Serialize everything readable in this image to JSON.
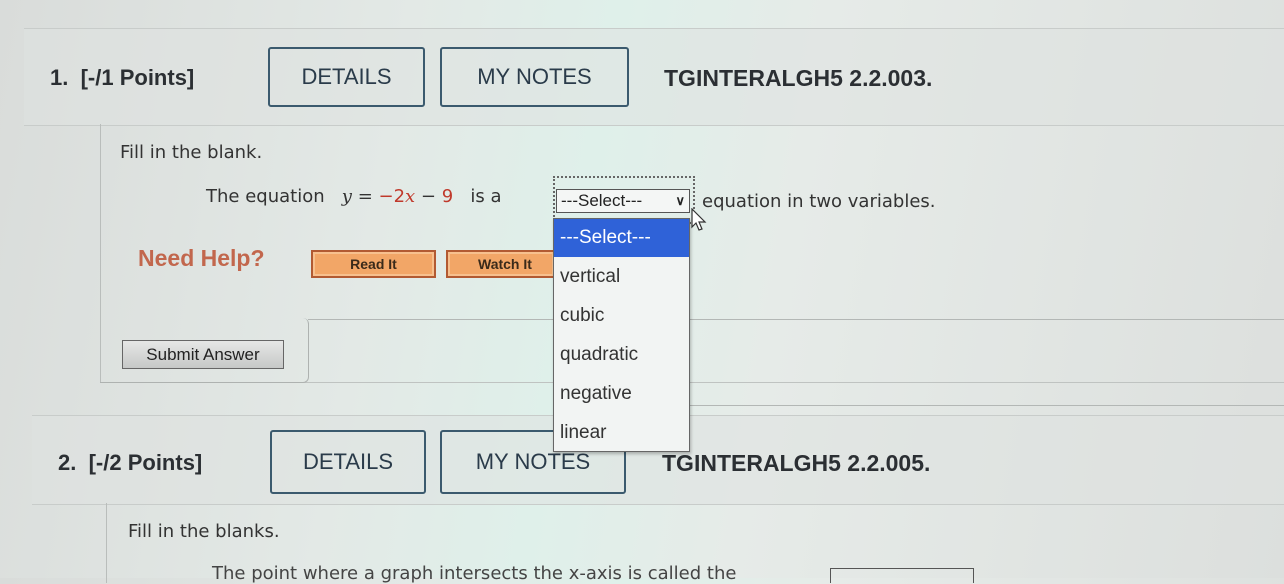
{
  "questions": [
    {
      "number_label": "1.",
      "points_label": "[-/1 Points]",
      "details_label": "DETAILS",
      "notes_label": "MY NOTES",
      "problem_id": "TGINTERALGH5 2.2.003.",
      "instruction": "Fill in the blank.",
      "sentence_prefix": "The equation",
      "equation": {
        "y": "y",
        "equals": " = ",
        "coef": "−2",
        "x": "x",
        "minus": " − ",
        "const": "9"
      },
      "sentence_mid": "is a",
      "sentence_suffix": "equation in two variables.",
      "select": {
        "current_value": "---Select---",
        "open": true,
        "options": [
          "---Select---",
          "vertical",
          "cubic",
          "quadratic",
          "negative",
          "linear"
        ],
        "highlighted_index": 0
      },
      "help": {
        "label": "Need Help?",
        "read_it": "Read It",
        "watch_it": "Watch It"
      },
      "submit_label": "Submit Answer"
    },
    {
      "number_label": "2.",
      "points_label": "[-/2 Points]",
      "details_label": "DETAILS",
      "notes_label": "MY NOTES",
      "problem_id": "TGINTERALGH5 2.2.005.",
      "instruction": "Fill in the blanks.",
      "sentence_partial": "The point where a graph intersects the x-axis is called the"
    }
  ],
  "colors": {
    "accent_blue": "#2f62d8",
    "help_orange": "#f2a667",
    "need_help_text": "#c2674d",
    "equation_red": "#c0392b"
  }
}
